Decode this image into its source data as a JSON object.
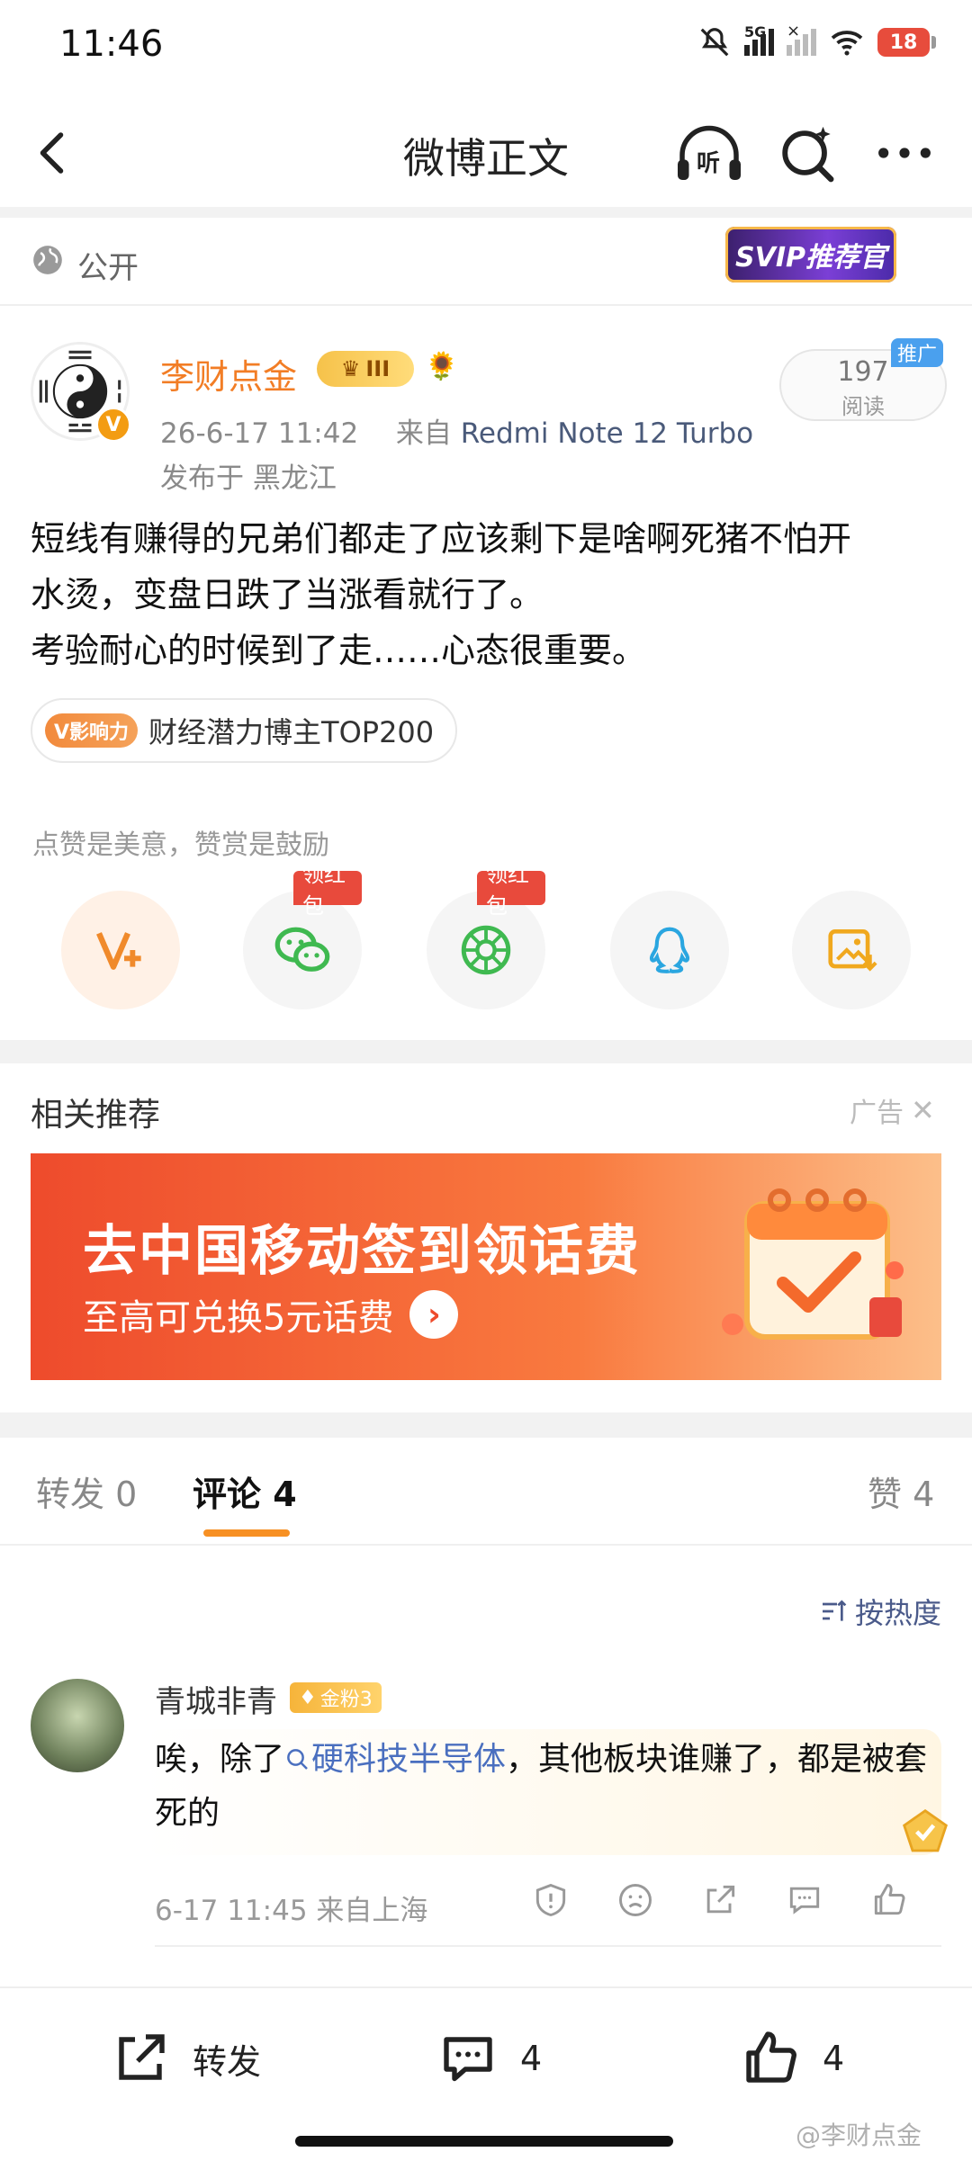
{
  "status_bar": {
    "time": "11:46",
    "network": "5G",
    "battery": "18"
  },
  "nav": {
    "title": "微博正文",
    "listen_label": "听"
  },
  "visibility": {
    "label": "公开",
    "svip_badge": "SVIP推荐官"
  },
  "author": {
    "name": "李财点金",
    "level_badge": "III",
    "timestamp": "26-6-17 11:42",
    "source_prefix": "来自",
    "device": "Redmi Note 12 Turbo",
    "location": "发布于 黑龙江",
    "read_count": "197",
    "read_label": "阅读",
    "promo_tag": "推广"
  },
  "post": {
    "line1": "短线有赚得的兄弟们都走了应该剩下是啥啊死猪不怕开",
    "line2": "水烫，变盘日跌了当涨看就行了。",
    "line3": "考验耐心的时候到了走……心态很重要。",
    "influence_icon": "V影响力",
    "influence_text": "财经潜力博主TOP200"
  },
  "reward": {
    "text": "点赞是美意，赞赏是鼓励"
  },
  "share": {
    "red_tag_1": "领红包",
    "red_tag_2": "领红包",
    "icons": [
      "reward-v-icon",
      "wechat-icon",
      "moments-icon",
      "qq-icon",
      "save-image-icon"
    ]
  },
  "recommend": {
    "title": "相关推荐",
    "ad_label": "广告",
    "banner_title": "去中国移动签到领话费",
    "banner_sub": "至高可兑换5元话费"
  },
  "tabs": {
    "repost": "转发 0",
    "comment": "评论 4",
    "like": "赞 4"
  },
  "sort": {
    "label": "按热度"
  },
  "comment": {
    "name": "青城非青",
    "badge": "金粉3",
    "text_before": "唉，除了",
    "topic": "硬科技半导体",
    "text_after": "，其他板块谁赚了，都是被套死的",
    "meta": "6-17 11:45  来自上海"
  },
  "bottom": {
    "repost_label": "转发",
    "comment_count": "4",
    "like_count": "4"
  },
  "watermark": "@李财点金"
}
